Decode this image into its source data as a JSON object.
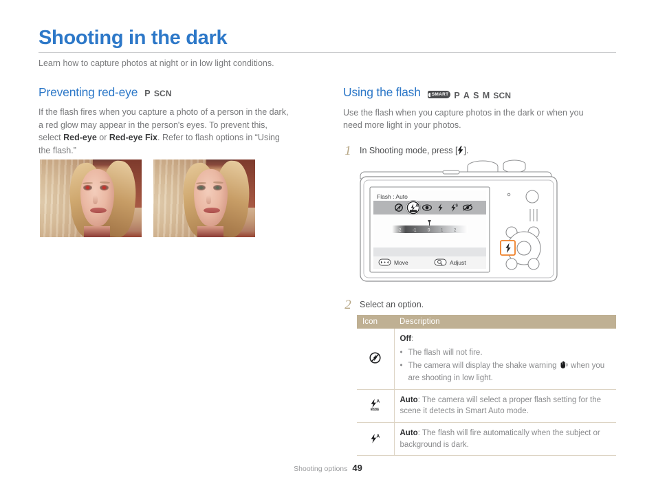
{
  "page": {
    "title": "Shooting in the dark",
    "subtitle": "Learn how to capture photos at night or in low light conditions.",
    "footer_label": "Shooting options",
    "footer_page": "49",
    "accent_blue": "#2d78c8",
    "accent_tan": "#bfb093",
    "highlight_orange": "#ef8028"
  },
  "left": {
    "section_title": "Preventing red-eye",
    "modes": [
      "P",
      "SCN"
    ],
    "paragraph_1": "If the flash fires when you capture a photo of a person in the dark,",
    "paragraph_2": "a red glow may appear in the person's eyes. To prevent this,",
    "paragraph_3_a": "select ",
    "paragraph_3_b": "Red-eye",
    "paragraph_3_c": " or ",
    "paragraph_3_d": "Red-eye Fix",
    "paragraph_3_e": ". Refer to flash options in “Using",
    "paragraph_4": "the flash.”",
    "photos": [
      {
        "name": "photo-red-eye",
        "caption": ""
      },
      {
        "name": "photo-red-eye-corrected",
        "caption": ""
      }
    ]
  },
  "right": {
    "section_title": "Using the flash",
    "modes": [
      "SMART",
      "P",
      "A",
      "S",
      "M",
      "SCN"
    ],
    "smart_badge_text": "SMART",
    "paragraph_1": "Use the flash when you capture photos in the dark or when you",
    "paragraph_2": "need more light in your photos.",
    "steps": [
      {
        "num": "1",
        "text_before": "In Shooting mode, press [",
        "icon": "flash-icon",
        "text_after": "]."
      },
      {
        "num": "2",
        "text_before": "Select an option.",
        "icon": "",
        "text_after": ""
      }
    ]
  },
  "camera": {
    "lcd_title": "Flash : Auto",
    "flash_options": [
      "flash-off-icon",
      "flash-smart-auto-icon",
      "red-eye-icon",
      "fill-in-icon",
      "slow-sync-icon",
      "red-eye-fix-icon"
    ],
    "selected_option_index": 1,
    "exposure_ticks": [
      "-2",
      "-1",
      "0",
      "1",
      "2"
    ],
    "exposure_marker": "0",
    "hint_move": "Move",
    "hint_adjust": "Adjust",
    "highlighted_button": "flash-button"
  },
  "table": {
    "headers": [
      "Icon",
      "Description"
    ],
    "rows": [
      {
        "icon": "flash-off-icon",
        "title": "Off",
        "title_suffix": ":",
        "bullets": [
          {
            "text_before": "The flash will not fire.",
            "icon": "",
            "text_after": ""
          },
          {
            "text_before": "The camera will display the shake warning ",
            "icon": "shake-warning-icon",
            "text_after": " when you are shooting in low light."
          }
        ],
        "description": ""
      },
      {
        "icon": "flash-smart-auto-icon",
        "title": "Auto",
        "title_suffix": ":",
        "bullets": [],
        "description": " The camera will select a proper flash setting for the scene it detects in Smart Auto mode."
      },
      {
        "icon": "flash-auto-icon",
        "title": "Auto",
        "title_suffix": ":",
        "bullets": [],
        "description": " The flash will fire automatically when the subject or background is dark."
      }
    ]
  }
}
